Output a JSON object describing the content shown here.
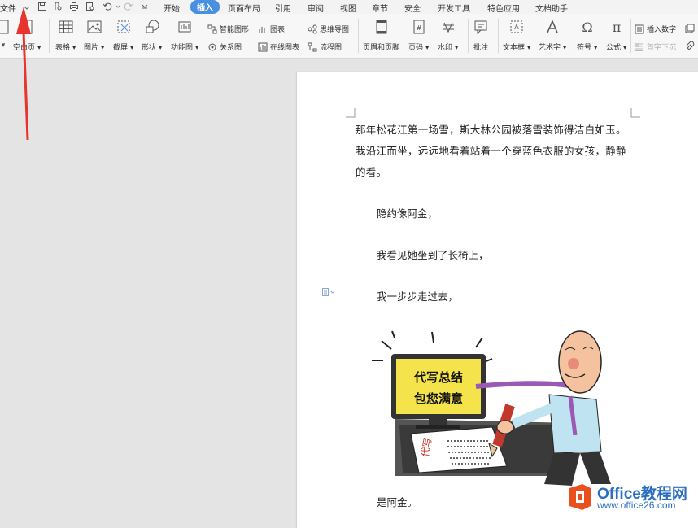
{
  "menubar": {
    "file_label": "文件",
    "tabs": [
      "开始",
      "插入",
      "页面布局",
      "引用",
      "审阅",
      "视图",
      "章节",
      "安全",
      "开发工具",
      "特色应用",
      "文档助手"
    ],
    "active_tab": "插入"
  },
  "ribbon": {
    "blank_page": "空白页",
    "table": "表格",
    "picture": "图片",
    "screenshot": "截屏",
    "shape": "形状",
    "function_chart": "功能图",
    "smart_graphic": "智能图形",
    "chart": "图表",
    "mind_map": "思维导图",
    "relation_graph": "关系图",
    "online_chart": "在线图表",
    "flowchart": "流程图",
    "header_footer": "页眉和页脚",
    "page_number": "页码",
    "watermark": "水印",
    "comment": "批注",
    "textbox": "文本框",
    "art_text": "艺术字",
    "symbol": "符号",
    "formula": "公式",
    "insert_number": "插入数字",
    "drop_cap": "首字下沉"
  },
  "document": {
    "intro_lines": [
      "那年松花江第一场雪，斯大林公园被落雪装饰得洁白如玉。",
      "我沿江而坐，远远地看着站着一个穿蓝色衣服的女孩，静静",
      "的看。"
    ],
    "line1": "隐约像阿金，",
    "line2": "我看见她坐到了长椅上，",
    "line3": "我一步步走过去，",
    "last_line": "是阿金。"
  },
  "cartoon": {
    "screen_line1": "代写总结",
    "screen_line2": "包您满意"
  },
  "watermark": {
    "title": "Office教程网",
    "url": "www.office26.com"
  },
  "colors": {
    "accent": "#4a90e2",
    "arrow": "#e8342f",
    "watermark_orange": "#e8501e",
    "watermark_blue": "#2a6fbf"
  }
}
